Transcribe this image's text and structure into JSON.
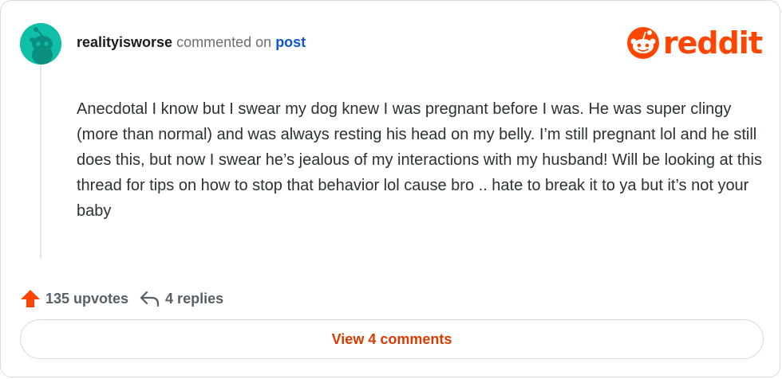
{
  "comment": {
    "username": "realityisworse",
    "action_text": "commented on",
    "post_link": "post",
    "body": "Anecdotal I know but I swear my dog knew I was pregnant before I was. He was super clingy (more than normal) and was always resting his head on my belly. I’m still pregnant lol and he still does this, but now I swear he’s jealous of my interactions with my husband! Will be looking at this thread for tips on how to stop that behavior lol cause bro .. hate to break it to ya but it’s not your baby"
  },
  "logo": {
    "text": "reddit",
    "color": "#ff4500"
  },
  "stats": {
    "upvotes": "135 upvotes",
    "replies": "4 replies"
  },
  "actions": {
    "view_comments": "View 4 comments"
  },
  "colors": {
    "avatar": "#0fbfa8",
    "accent": "#ff4500",
    "link": "#0b57d0",
    "button_text": "#d93a00"
  },
  "icons": {
    "avatar": "snoo-avatar-icon",
    "logo": "reddit-snoo-icon",
    "upvote": "upvote-arrow-icon",
    "reply": "reply-arrow-icon"
  }
}
